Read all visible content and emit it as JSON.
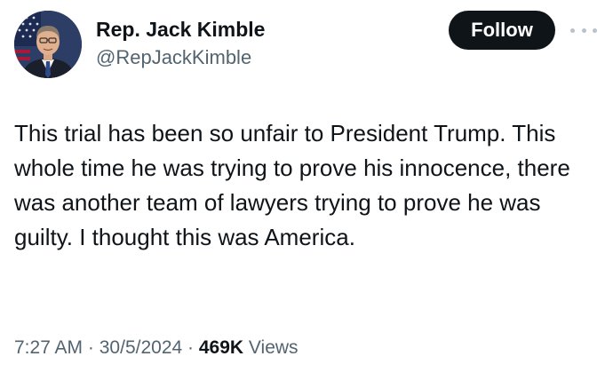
{
  "author": {
    "display_name": "Rep. Jack Kimble",
    "handle": "@RepJackKimble",
    "avatar_icon": "profile-photo"
  },
  "actions": {
    "follow_label": "Follow",
    "more_icon": "more-dots-icon"
  },
  "tweet": {
    "text": "This trial has been so unfair to President Trump. This whole time he was trying to prove his innocence, there was another team of lawyers trying to prove he was guilty. I thought this was America."
  },
  "meta": {
    "time": "7:27 AM",
    "separator": "·",
    "date": "30/5/2024",
    "views_count": "469K",
    "views_label": "Views"
  },
  "colors": {
    "text_primary": "#0f1419",
    "text_secondary": "#536471",
    "button_bg": "#0f1419",
    "button_text": "#ffffff"
  }
}
